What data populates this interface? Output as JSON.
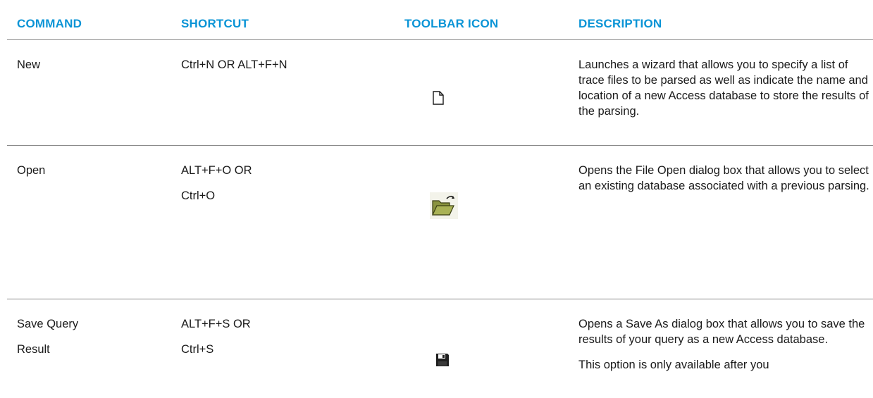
{
  "headers": {
    "command": "COMMAND",
    "shortcut": "SHORTCUT",
    "toolbar_icon": "TOOLBAR ICON",
    "description": "DESCRIPTION"
  },
  "rows": [
    {
      "command": [
        "New"
      ],
      "shortcut": [
        "Ctrl+N OR ALT+F+N"
      ],
      "icon": "new-document-icon",
      "description": [
        "Launches a wizard that allows you to specify a list of trace files to be parsed as well as indicate the name and location of a new Access database to store the results of the parsing."
      ]
    },
    {
      "command": [
        "Open"
      ],
      "shortcut": [
        "ALT+F+O OR",
        "Ctrl+O"
      ],
      "icon": "open-folder-icon",
      "description": [
        "Opens the File Open dialog box that allows you to select an existing database associated with a previous parsing."
      ]
    },
    {
      "command": [
        "Save Query",
        "Result"
      ],
      "shortcut": [
        "ALT+F+S OR",
        "Ctrl+S"
      ],
      "icon": "save-floppy-icon",
      "description": [
        "Opens a Save As dialog box that allows you to save the results of your query as a new Access database.",
        "This option is only available after you"
      ]
    }
  ],
  "colors": {
    "header_text": "#0a94d6",
    "rule": "#8a8a8a",
    "body_text": "#1a1a1a",
    "folder": "#6e7a2e"
  }
}
